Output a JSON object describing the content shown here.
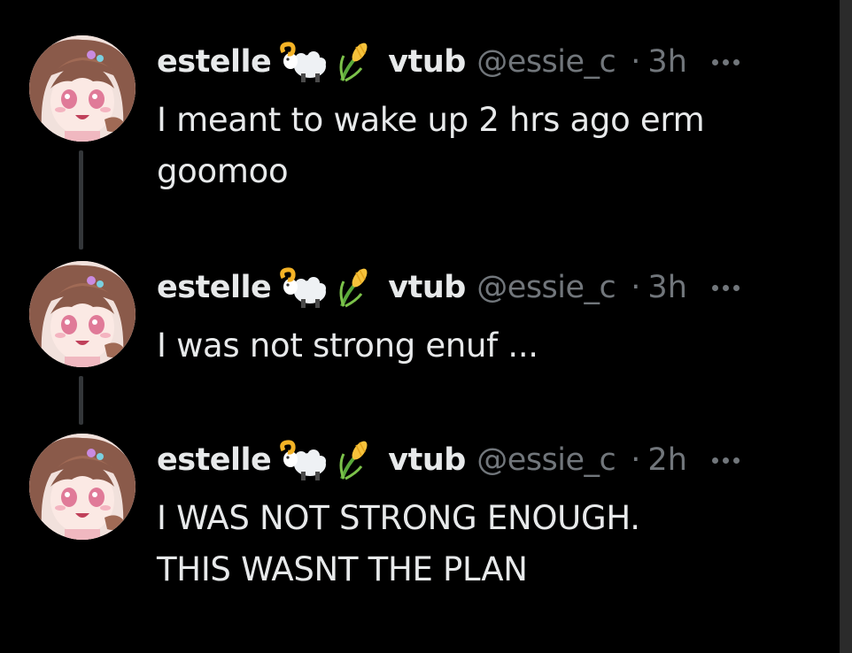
{
  "tweets": [
    {
      "display_name": "estelle",
      "name_tail": "vtub",
      "handle": "@essie_c",
      "separator": "·",
      "time": "3h",
      "text_line1": "I meant to wake up 2 hrs ago erm",
      "text_line2": "goomoo"
    },
    {
      "display_name": "estelle",
      "name_tail": "vtub",
      "handle": "@essie_c",
      "separator": "·",
      "time": "3h",
      "text_line1": "I was not strong enuf ...",
      "text_line2": ""
    },
    {
      "display_name": "estelle",
      "name_tail": "vtub",
      "handle": "@essie_c",
      "separator": "·",
      "time": "2h",
      "text_line1": "I WAS NOT STRONG ENOUGH.",
      "text_line2": "THIS WASNT THE PLAN"
    }
  ],
  "icons": {
    "name_emoji_1": "ram-icon",
    "name_emoji_2": "corn-icon",
    "more": "more-options-icon"
  },
  "colors": {
    "background": "#000000",
    "text_primary": "#e7e9ea",
    "text_secondary": "#71767b",
    "thread_line": "#333639"
  }
}
